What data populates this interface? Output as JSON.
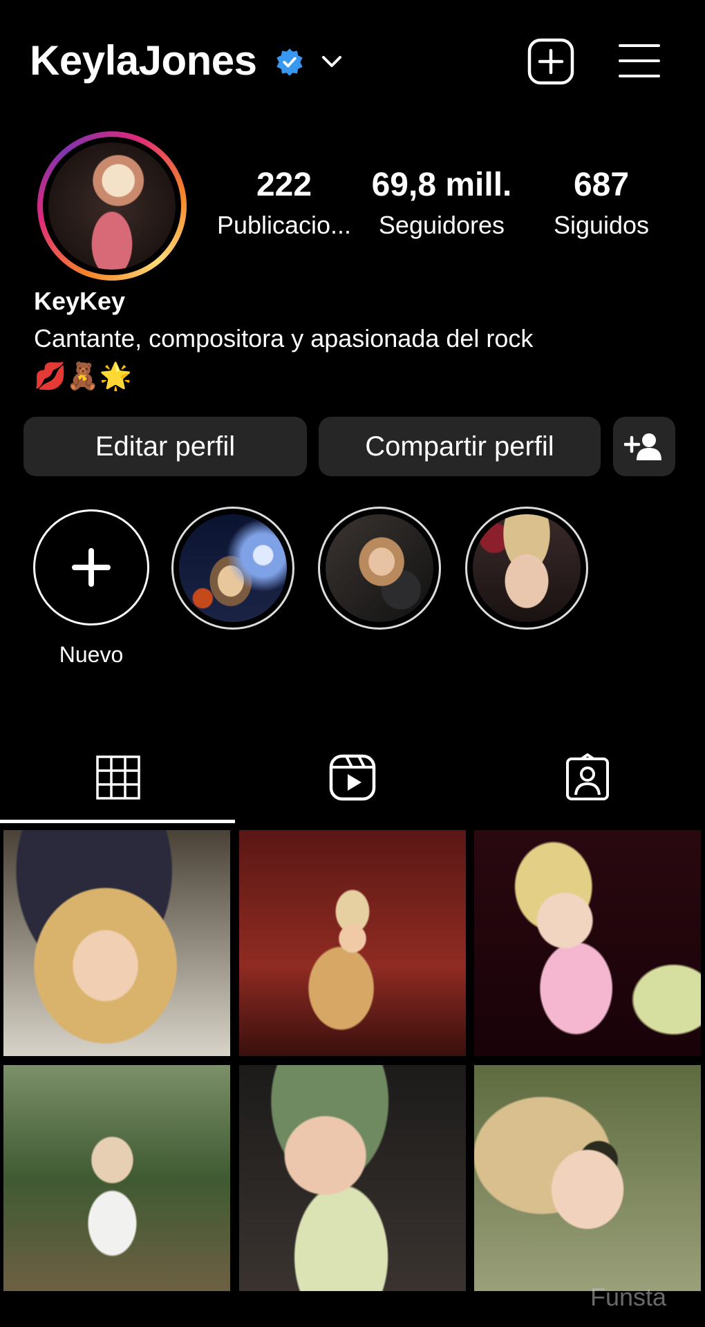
{
  "header": {
    "username": "KeylaJones"
  },
  "profile": {
    "stats": [
      {
        "value": "222",
        "label": "Publicacio..."
      },
      {
        "value": "69,8 mill.",
        "label": "Seguidores"
      },
      {
        "value": "687",
        "label": "Siguidos"
      }
    ],
    "display_name": "KeyKey",
    "bio": "Cantante, compositora y apasionada del rock",
    "bio_emojis": "💋🧸🌟"
  },
  "actions": {
    "edit_label": "Editar perfil",
    "share_label": "Compartir perfil"
  },
  "highlights": {
    "new_label": "Nuevo"
  },
  "tabs": [
    {
      "icon": "grid-icon",
      "active": true
    },
    {
      "icon": "reels-icon",
      "active": false
    },
    {
      "icon": "tagged-icon",
      "active": false
    }
  ],
  "watermark": "Funsta",
  "colors": {
    "background": "#000000",
    "button_bg": "#262626",
    "verified": "#3897f0"
  }
}
